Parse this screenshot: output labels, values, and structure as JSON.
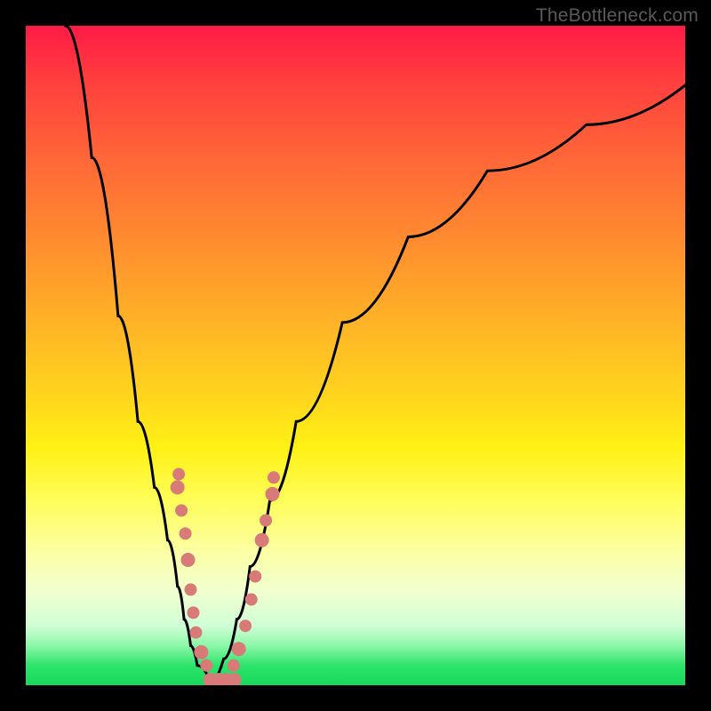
{
  "watermark": "TheBottleneck.com",
  "chart_data": {
    "type": "line",
    "title": "",
    "xlabel": "",
    "ylabel": "",
    "xlim": [
      0,
      100
    ],
    "ylim": [
      0,
      100
    ],
    "series": [
      {
        "name": "bottleneck-curve-left",
        "x": [
          6,
          10,
          14,
          17,
          19.5,
          21.5,
          23,
          24,
          25,
          26,
          28
        ],
        "y": [
          100,
          80,
          56,
          40,
          30,
          22,
          15,
          10,
          6,
          3,
          0.5
        ]
      },
      {
        "name": "bottleneck-curve-right",
        "x": [
          28,
          30,
          32,
          34,
          37,
          41,
          48,
          58,
          70,
          85,
          100
        ],
        "y": [
          0.5,
          4,
          10,
          18,
          28,
          40,
          55,
          68,
          78,
          85,
          91
        ]
      }
    ],
    "markers": {
      "left_cluster": [
        {
          "x": 23.2,
          "y": 32.0,
          "r": 7
        },
        {
          "x": 23.0,
          "y": 30.0,
          "r": 8
        },
        {
          "x": 23.6,
          "y": 26.5,
          "r": 7
        },
        {
          "x": 24.2,
          "y": 23.0,
          "r": 7
        },
        {
          "x": 24.6,
          "y": 19.0,
          "r": 8
        },
        {
          "x": 25.0,
          "y": 14.5,
          "r": 7
        },
        {
          "x": 25.4,
          "y": 11.0,
          "r": 7
        },
        {
          "x": 25.8,
          "y": 8.0,
          "r": 7
        },
        {
          "x": 26.6,
          "y": 5.0,
          "r": 8
        },
        {
          "x": 27.4,
          "y": 3.0,
          "r": 7
        }
      ],
      "right_cluster": [
        {
          "x": 31.5,
          "y": 3.0,
          "r": 7
        },
        {
          "x": 32.3,
          "y": 5.5,
          "r": 8
        },
        {
          "x": 33.3,
          "y": 9.0,
          "r": 7
        },
        {
          "x": 34.2,
          "y": 13.0,
          "r": 7
        },
        {
          "x": 34.8,
          "y": 16.5,
          "r": 7
        },
        {
          "x": 35.8,
          "y": 22.0,
          "r": 8
        },
        {
          "x": 36.4,
          "y": 25.0,
          "r": 7
        },
        {
          "x": 37.4,
          "y": 29.0,
          "r": 8
        },
        {
          "x": 37.6,
          "y": 31.5,
          "r": 7
        }
      ],
      "bottom_bar": [
        {
          "x": 28.0,
          "y": 0.8,
          "r": 8
        },
        {
          "x": 29.2,
          "y": 0.8,
          "r": 8
        },
        {
          "x": 30.4,
          "y": 0.8,
          "r": 8
        },
        {
          "x": 31.6,
          "y": 0.8,
          "r": 8
        }
      ]
    },
    "colors": {
      "marker": "#d87a78",
      "curve": "#000000"
    }
  }
}
